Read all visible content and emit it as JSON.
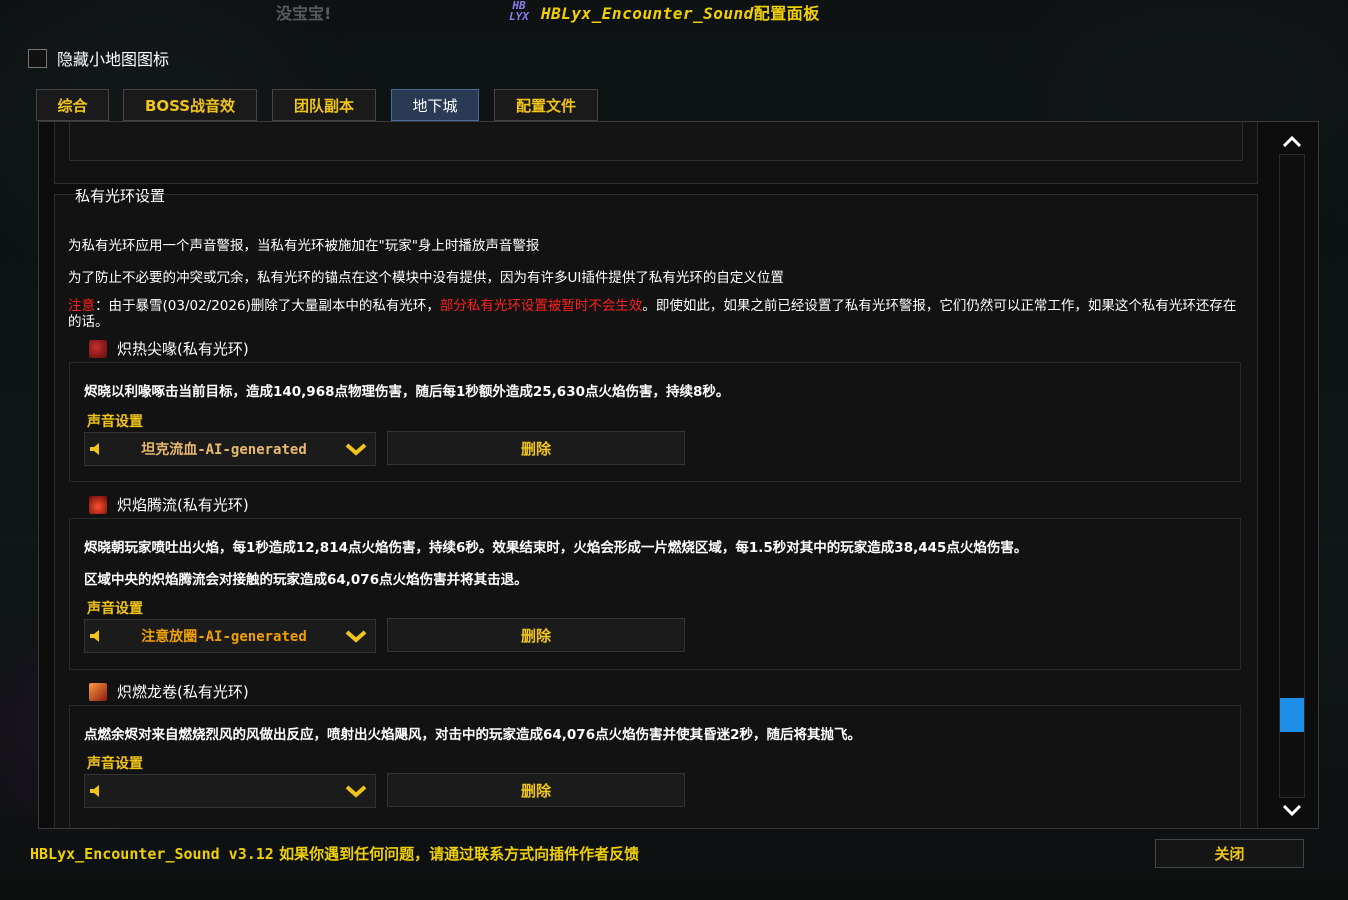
{
  "window": {
    "ghost_text": "没宝宝!",
    "logo_top": "HB",
    "logo_bottom": "LYX",
    "title_addon": "HBLyx_Encounter_Sound",
    "title_suffix": "配置面板"
  },
  "options": {
    "hide_minimap_label": "隐藏小地图图标",
    "hide_minimap_checked": false
  },
  "tabs": [
    {
      "label": "综合",
      "active": false
    },
    {
      "label": "BOSS战音效",
      "active": false
    },
    {
      "label": "团队副本",
      "active": false
    },
    {
      "label": "地下城",
      "active": true
    },
    {
      "label": "配置文件",
      "active": false
    }
  ],
  "section": {
    "title": "私有光环设置",
    "desc1": "为私有光环应用一个声音警报，当私有光环被施加在\"玩家\"身上时播放声音警报",
    "desc2": "为了防止不必要的冲突或冗余，私有光环的锚点在这个模块中没有提供，因为有许多UI插件提供了私有光环的自定义位置",
    "note_prefix": "注意",
    "note_part1": "：由于暴雪(03/02/2026)删除了大量副本中的私有光环，",
    "note_red": "部分私有光环设置被暂时不会生效",
    "note_part2": "。即使如此，如果之前已经设置了私有光环警报，它们仍然可以正常工作，如果这个私有光环还存在的话。"
  },
  "auras": [
    {
      "name": "炽热尖喙(私有光环)",
      "icon": "beak-icon",
      "desc_lines": [
        "烬晓以利喙啄击当前目标，造成140,968点物理伤害，随后每1秒额外造成25,630点火焰伤害，持续8秒。"
      ],
      "sound_label": "声音设置",
      "sound_value": "坦克流血-AI-generated",
      "sound_color": "#e8b96a",
      "delete_label": "删除"
    },
    {
      "name": "炽焰腾流(私有光环)",
      "icon": "flame-icon",
      "desc_lines": [
        "烬晓朝玩家喷吐出火焰，每1秒造成12,814点火焰伤害，持续6秒。效果结束时，火焰会形成一片燃烧区域，每1.5秒对其中的玩家造成38,445点火焰伤害。",
        "区域中央的炽焰腾流会对接触的玩家造成64,076点火焰伤害并将其击退。"
      ],
      "sound_label": "声音设置",
      "sound_value": "注意放圈-AI-generated",
      "sound_color": "#f0a000",
      "delete_label": "删除"
    },
    {
      "name": "炽燃龙卷(私有光环)",
      "icon": "tornado-icon",
      "desc_lines": [
        "点燃余烬对来自燃烧烈风的风做出反应，喷射出火焰飓风，对击中的玩家造成64,076点火焰伤害并使其昏迷2秒，随后将其抛飞。"
      ],
      "sound_label": "声音设置",
      "sound_value": "",
      "sound_color": "#f0c419",
      "delete_label": "删除"
    }
  ],
  "footer": {
    "version_text": "HBLyx_Encounter_Sound v3.12",
    "feedback_text": "如果你遇到任何问题，请通过联系方式向插件作者反馈",
    "close_label": "关闭"
  },
  "colors": {
    "accent_gold": "#f0c419",
    "title_yellow": "#f0d000",
    "warning_red": "#ff2020",
    "scroll_thumb": "#1e8fe6",
    "active_tab": "#2a3a55"
  }
}
